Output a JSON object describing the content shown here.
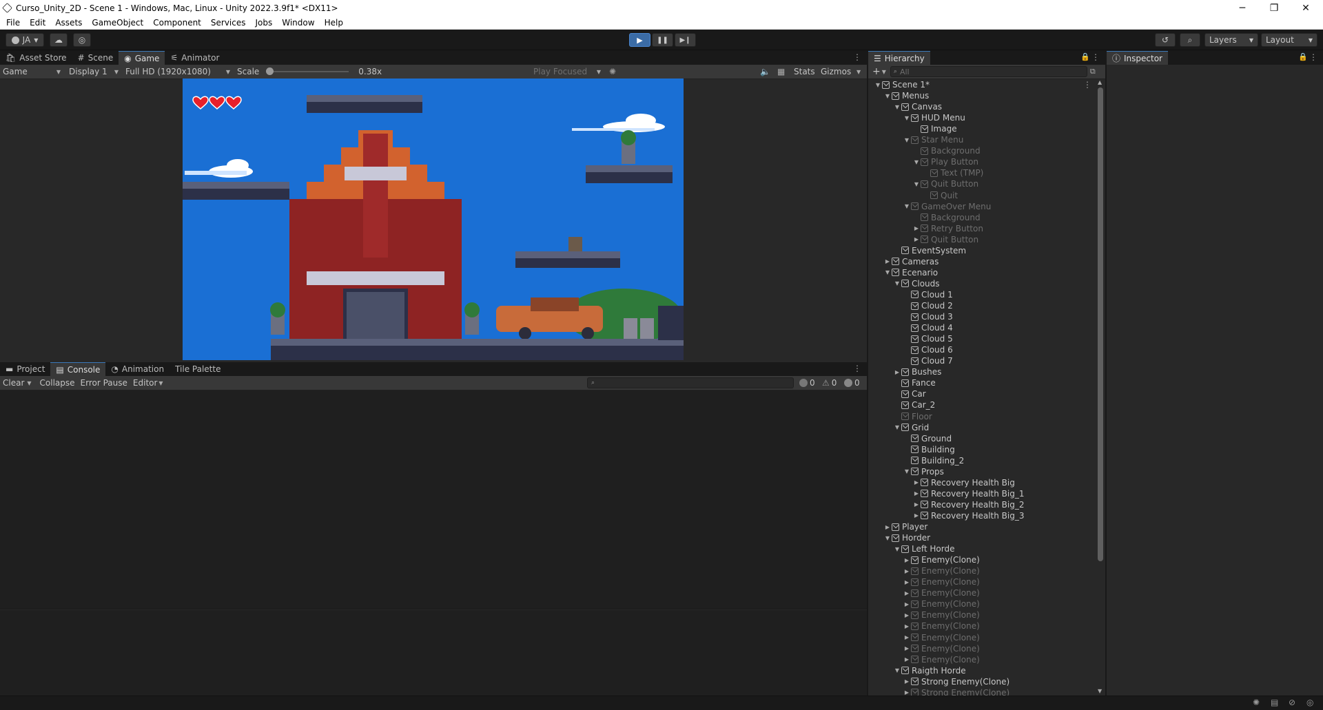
{
  "window": {
    "title": "Curso_Unity_2D - Scene 1 - Windows, Mac, Linux - Unity 2022.3.9f1* <DX11>",
    "minimize": "─",
    "maximize": "❐",
    "close": "✕"
  },
  "menu": [
    "File",
    "Edit",
    "Assets",
    "GameObject",
    "Component",
    "Services",
    "Jobs",
    "Window",
    "Help"
  ],
  "toolbar": {
    "account": "JA",
    "layers": "Layers",
    "layout": "Layout"
  },
  "game_panel": {
    "tabs": [
      "Asset Store",
      "Scene",
      "Game",
      "Animator"
    ],
    "active_tab": "Game",
    "view_mode": "Game",
    "display": "Display 1",
    "resolution": "Full HD (1920x1080)",
    "scale_label": "Scale",
    "scale_value": "0.38x",
    "scale_fraction": 0.0,
    "play_focused": "Play Focused",
    "stats": "Stats",
    "gizmos": "Gizmos",
    "hearts": 3,
    "sky_color": "#1a6fd4"
  },
  "console_panel": {
    "tabs": [
      "Project",
      "Console",
      "Animation",
      "Tile Palette"
    ],
    "active_tab": "Console",
    "buttons": {
      "clear": "Clear",
      "collapse": "Collapse",
      "error_pause": "Error Pause",
      "editor": "Editor"
    },
    "counts": {
      "info": "0",
      "warnings": "0",
      "errors": "0"
    }
  },
  "hierarchy": {
    "tab": "Hierarchy",
    "search_placeholder": "All",
    "items": [
      {
        "label": "Scene 1*",
        "depth": 0,
        "arrow": "open",
        "dim": false,
        "scene": true
      },
      {
        "label": "Menus",
        "depth": 1,
        "arrow": "open",
        "dim": false
      },
      {
        "label": "Canvas",
        "depth": 2,
        "arrow": "open",
        "dim": false
      },
      {
        "label": "HUD Menu",
        "depth": 3,
        "arrow": "open",
        "dim": false
      },
      {
        "label": "Image",
        "depth": 4,
        "arrow": "",
        "dim": false
      },
      {
        "label": "Star Menu",
        "depth": 3,
        "arrow": "open",
        "dim": true
      },
      {
        "label": "Background",
        "depth": 4,
        "arrow": "",
        "dim": true
      },
      {
        "label": "Play Button",
        "depth": 4,
        "arrow": "open",
        "dim": true
      },
      {
        "label": "Text (TMP)",
        "depth": 5,
        "arrow": "",
        "dim": true
      },
      {
        "label": "Quit Button",
        "depth": 4,
        "arrow": "open",
        "dim": true
      },
      {
        "label": "Quit",
        "depth": 5,
        "arrow": "",
        "dim": true
      },
      {
        "label": "GameOver Menu",
        "depth": 3,
        "arrow": "open",
        "dim": true
      },
      {
        "label": "Background",
        "depth": 4,
        "arrow": "",
        "dim": true
      },
      {
        "label": "Retry Button",
        "depth": 4,
        "arrow": "closed",
        "dim": true
      },
      {
        "label": "Quit Button",
        "depth": 4,
        "arrow": "closed",
        "dim": true
      },
      {
        "label": "EventSystem",
        "depth": 2,
        "arrow": "",
        "dim": false
      },
      {
        "label": "Cameras",
        "depth": 1,
        "arrow": "closed",
        "dim": false
      },
      {
        "label": "Ecenario",
        "depth": 1,
        "arrow": "open",
        "dim": false
      },
      {
        "label": "Clouds",
        "depth": 2,
        "arrow": "open",
        "dim": false
      },
      {
        "label": "Cloud 1",
        "depth": 3,
        "arrow": "",
        "dim": false
      },
      {
        "label": "Cloud 2",
        "depth": 3,
        "arrow": "",
        "dim": false
      },
      {
        "label": "Cloud 3",
        "depth": 3,
        "arrow": "",
        "dim": false
      },
      {
        "label": "Cloud 4",
        "depth": 3,
        "arrow": "",
        "dim": false
      },
      {
        "label": "Cloud 5",
        "depth": 3,
        "arrow": "",
        "dim": false
      },
      {
        "label": "Cloud 6",
        "depth": 3,
        "arrow": "",
        "dim": false
      },
      {
        "label": "Cloud 7",
        "depth": 3,
        "arrow": "",
        "dim": false
      },
      {
        "label": "Bushes",
        "depth": 2,
        "arrow": "closed",
        "dim": false
      },
      {
        "label": "Fance",
        "depth": 2,
        "arrow": "",
        "dim": false
      },
      {
        "label": "Car",
        "depth": 2,
        "arrow": "",
        "dim": false
      },
      {
        "label": "Car_2",
        "depth": 2,
        "arrow": "",
        "dim": false
      },
      {
        "label": "Floor",
        "depth": 2,
        "arrow": "",
        "dim": true
      },
      {
        "label": "Grid",
        "depth": 2,
        "arrow": "open",
        "dim": false
      },
      {
        "label": "Ground",
        "depth": 3,
        "arrow": "",
        "dim": false
      },
      {
        "label": "Building",
        "depth": 3,
        "arrow": "",
        "dim": false
      },
      {
        "label": "Building_2",
        "depth": 3,
        "arrow": "",
        "dim": false
      },
      {
        "label": "Props",
        "depth": 3,
        "arrow": "open",
        "dim": false
      },
      {
        "label": "Recovery Health Big",
        "depth": 4,
        "arrow": "closed",
        "dim": false
      },
      {
        "label": "Recovery Health Big_1",
        "depth": 4,
        "arrow": "closed",
        "dim": false
      },
      {
        "label": "Recovery Health Big_2",
        "depth": 4,
        "arrow": "closed",
        "dim": false
      },
      {
        "label": "Recovery Health Big_3",
        "depth": 4,
        "arrow": "closed",
        "dim": false
      },
      {
        "label": "Player",
        "depth": 1,
        "arrow": "closed",
        "dim": false
      },
      {
        "label": "Horder",
        "depth": 1,
        "arrow": "open",
        "dim": false
      },
      {
        "label": "Left Horde",
        "depth": 2,
        "arrow": "open",
        "dim": false
      },
      {
        "label": "Enemy(Clone)",
        "depth": 3,
        "arrow": "closed",
        "dim": false
      },
      {
        "label": "Enemy(Clone)",
        "depth": 3,
        "arrow": "closed",
        "dim": true
      },
      {
        "label": "Enemy(Clone)",
        "depth": 3,
        "arrow": "closed",
        "dim": true
      },
      {
        "label": "Enemy(Clone)",
        "depth": 3,
        "arrow": "closed",
        "dim": true
      },
      {
        "label": "Enemy(Clone)",
        "depth": 3,
        "arrow": "closed",
        "dim": true
      },
      {
        "label": "Enemy(Clone)",
        "depth": 3,
        "arrow": "closed",
        "dim": true
      },
      {
        "label": "Enemy(Clone)",
        "depth": 3,
        "arrow": "closed",
        "dim": true
      },
      {
        "label": "Enemy(Clone)",
        "depth": 3,
        "arrow": "closed",
        "dim": true
      },
      {
        "label": "Enemy(Clone)",
        "depth": 3,
        "arrow": "closed",
        "dim": true
      },
      {
        "label": "Enemy(Clone)",
        "depth": 3,
        "arrow": "closed",
        "dim": true
      },
      {
        "label": "Raigth Horde",
        "depth": 2,
        "arrow": "open",
        "dim": false
      },
      {
        "label": "Strong Enemy(Clone)",
        "depth": 3,
        "arrow": "closed",
        "dim": false
      },
      {
        "label": "Strong Enemy(Clone)",
        "depth": 3,
        "arrow": "closed",
        "dim": true
      }
    ]
  },
  "inspector": {
    "tab": "Inspector"
  }
}
